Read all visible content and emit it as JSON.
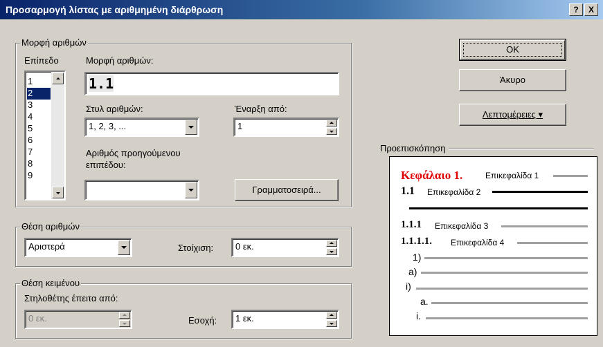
{
  "window": {
    "title": "Προσαρμογή λίστας με αριθμημένη διάρθρωση",
    "help_btn": "?",
    "close_btn": "X"
  },
  "number_format": {
    "group_label": "Μορφή αριθμών",
    "level_label": "Επίπεδο",
    "levels": [
      "1",
      "2",
      "3",
      "4",
      "5",
      "6",
      "7",
      "8",
      "9"
    ],
    "selected_level": "2",
    "format_label": "Μορφή αριθμών:",
    "format_value": "1.1",
    "style_label": "Στυλ αριθμών:",
    "style_value": "1, 2, 3, ...",
    "start_label": "Έναρξη από:",
    "start_value": "1",
    "prev_level_label_1": "Αριθμός προηγούμενου",
    "prev_level_label_2": "επιπέδου:",
    "prev_level_value": "",
    "font_button": "Γραμματοσειρά..."
  },
  "number_position": {
    "group_label": "Θέση αριθμών",
    "align_value": "Αριστερά",
    "aligned_at_label": "Στοίχιση:",
    "aligned_at_value": "0 εκ."
  },
  "text_position": {
    "group_label": "Θέση κειμένου",
    "tab_after_label": "Στηλοθέτης έπειτα από:",
    "tab_after_value": "0 εκ.",
    "indent_label": "Εσοχή:",
    "indent_value": "1 εκ."
  },
  "buttons": {
    "ok": "OK",
    "cancel": "Άκυρο",
    "details": "Λεπτομέρειες ▾"
  },
  "preview": {
    "label": "Προεπισκόπηση",
    "l1_num": "Κεφάλαιο 1.",
    "l1_text": "Επικεφαλίδα 1",
    "l2_num": "1.1",
    "l2_text": "Επικεφαλίδα 2",
    "l3_num": "1.1.1",
    "l3_text": "Επικεφαλίδα 3",
    "l4_num": "1.1.1.1.",
    "l4_text": "Επικεφαλίδα 4",
    "l5": "1)",
    "l6": "a)",
    "l7": "i)",
    "l8": "a.",
    "l9": "i."
  },
  "colors": {
    "accent_red": "#e00000",
    "titlebar": "#0a246a",
    "face": "#d4d0c8"
  }
}
